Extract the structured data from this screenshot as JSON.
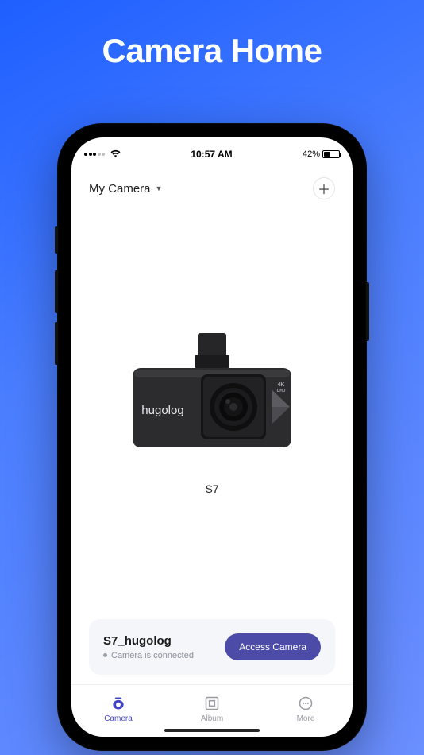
{
  "hero": {
    "title": "Camera Home"
  },
  "status_bar": {
    "time": "10:57 AM",
    "battery_pct": "42%"
  },
  "header": {
    "title": "My Camera"
  },
  "camera": {
    "brand": "hugolog",
    "badge": "4K UHD",
    "model": "S7"
  },
  "card": {
    "device_name": "S7_hugolog",
    "status_text": "Camera is connected",
    "button_label": "Access Camera"
  },
  "nav": {
    "items": [
      {
        "label": "Camera"
      },
      {
        "label": "Album"
      },
      {
        "label": "More"
      }
    ]
  },
  "colors": {
    "accent": "#4444c8",
    "button": "#4c4ca8"
  }
}
